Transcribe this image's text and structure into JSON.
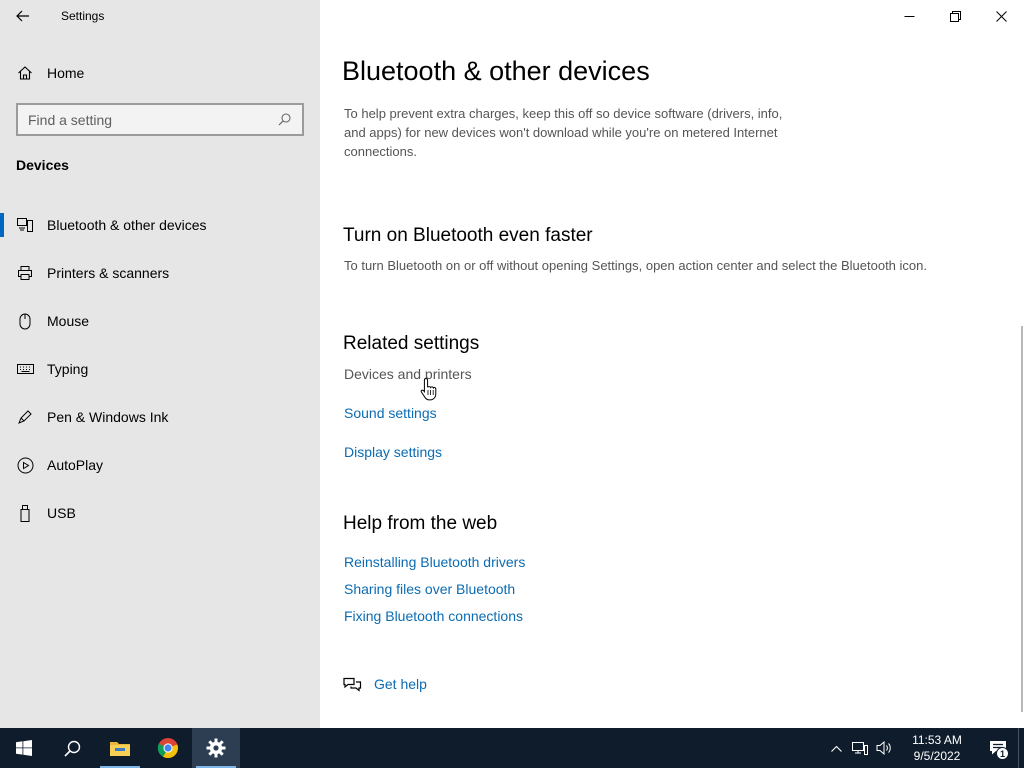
{
  "window": {
    "app_title": "Settings"
  },
  "sidebar": {
    "home_label": "Home",
    "search_placeholder": "Find a setting",
    "section_title": "Devices",
    "items": [
      {
        "label": "Bluetooth & other devices",
        "icon": "bluetooth-devices-icon",
        "active": true
      },
      {
        "label": "Printers & scanners",
        "icon": "printer-icon",
        "active": false
      },
      {
        "label": "Mouse",
        "icon": "mouse-icon",
        "active": false
      },
      {
        "label": "Typing",
        "icon": "keyboard-icon",
        "active": false
      },
      {
        "label": "Pen & Windows Ink",
        "icon": "pen-icon",
        "active": false
      },
      {
        "label": "AutoPlay",
        "icon": "autoplay-icon",
        "active": false
      },
      {
        "label": "USB",
        "icon": "usb-icon",
        "active": false
      }
    ]
  },
  "main": {
    "title": "Bluetooth & other devices",
    "intro": "To help prevent extra charges, keep this off so device software (drivers, info, and apps) for new devices won't download while you're on metered Internet connections.",
    "faster": {
      "heading": "Turn on Bluetooth even faster",
      "description": "To turn Bluetooth on or off without opening Settings, open action center and select the Bluetooth icon."
    },
    "related": {
      "heading": "Related settings",
      "items": [
        "Devices and printers",
        "Sound settings",
        "Display settings"
      ]
    },
    "help": {
      "heading": "Help from the web",
      "links": [
        "Reinstalling Bluetooth drivers",
        "Sharing files over Bluetooth",
        "Fixing Bluetooth connections"
      ]
    },
    "get_help": "Get help"
  },
  "taskbar": {
    "apps": [
      "start-icon",
      "search-icon",
      "file-explorer-icon",
      "chrome-icon",
      "settings-icon"
    ],
    "time": "11:53 AM",
    "date": "9/5/2022",
    "notification_count": "1"
  },
  "colors": {
    "accent": "#0067c0",
    "link": "#0b6cb3",
    "sidebar_bg": "#e6e6e6",
    "taskbar_bg": "#0f1c2c"
  }
}
